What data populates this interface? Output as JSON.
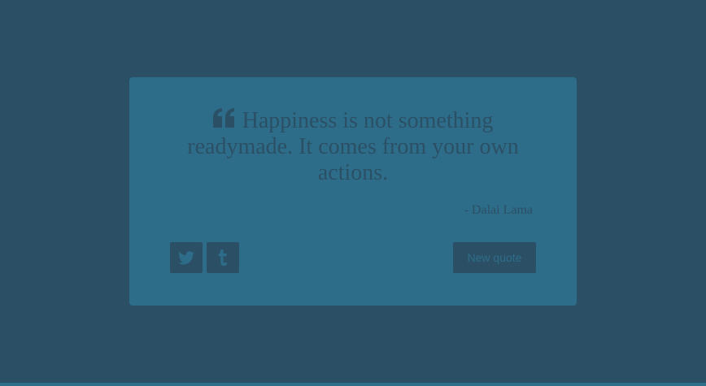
{
  "quote": {
    "icon": "quote-left-icon",
    "text": "Happiness is not something readymade. It comes from your own actions.",
    "author": "- Dalai Lama"
  },
  "actions": {
    "twitter_icon": "twitter-icon",
    "tumblr_icon": "tumblr-icon",
    "new_quote_label": "New quote"
  },
  "colors": {
    "page_background": "#2b5066",
    "card_background": "#2e6d89",
    "accent": "#2b5066"
  }
}
